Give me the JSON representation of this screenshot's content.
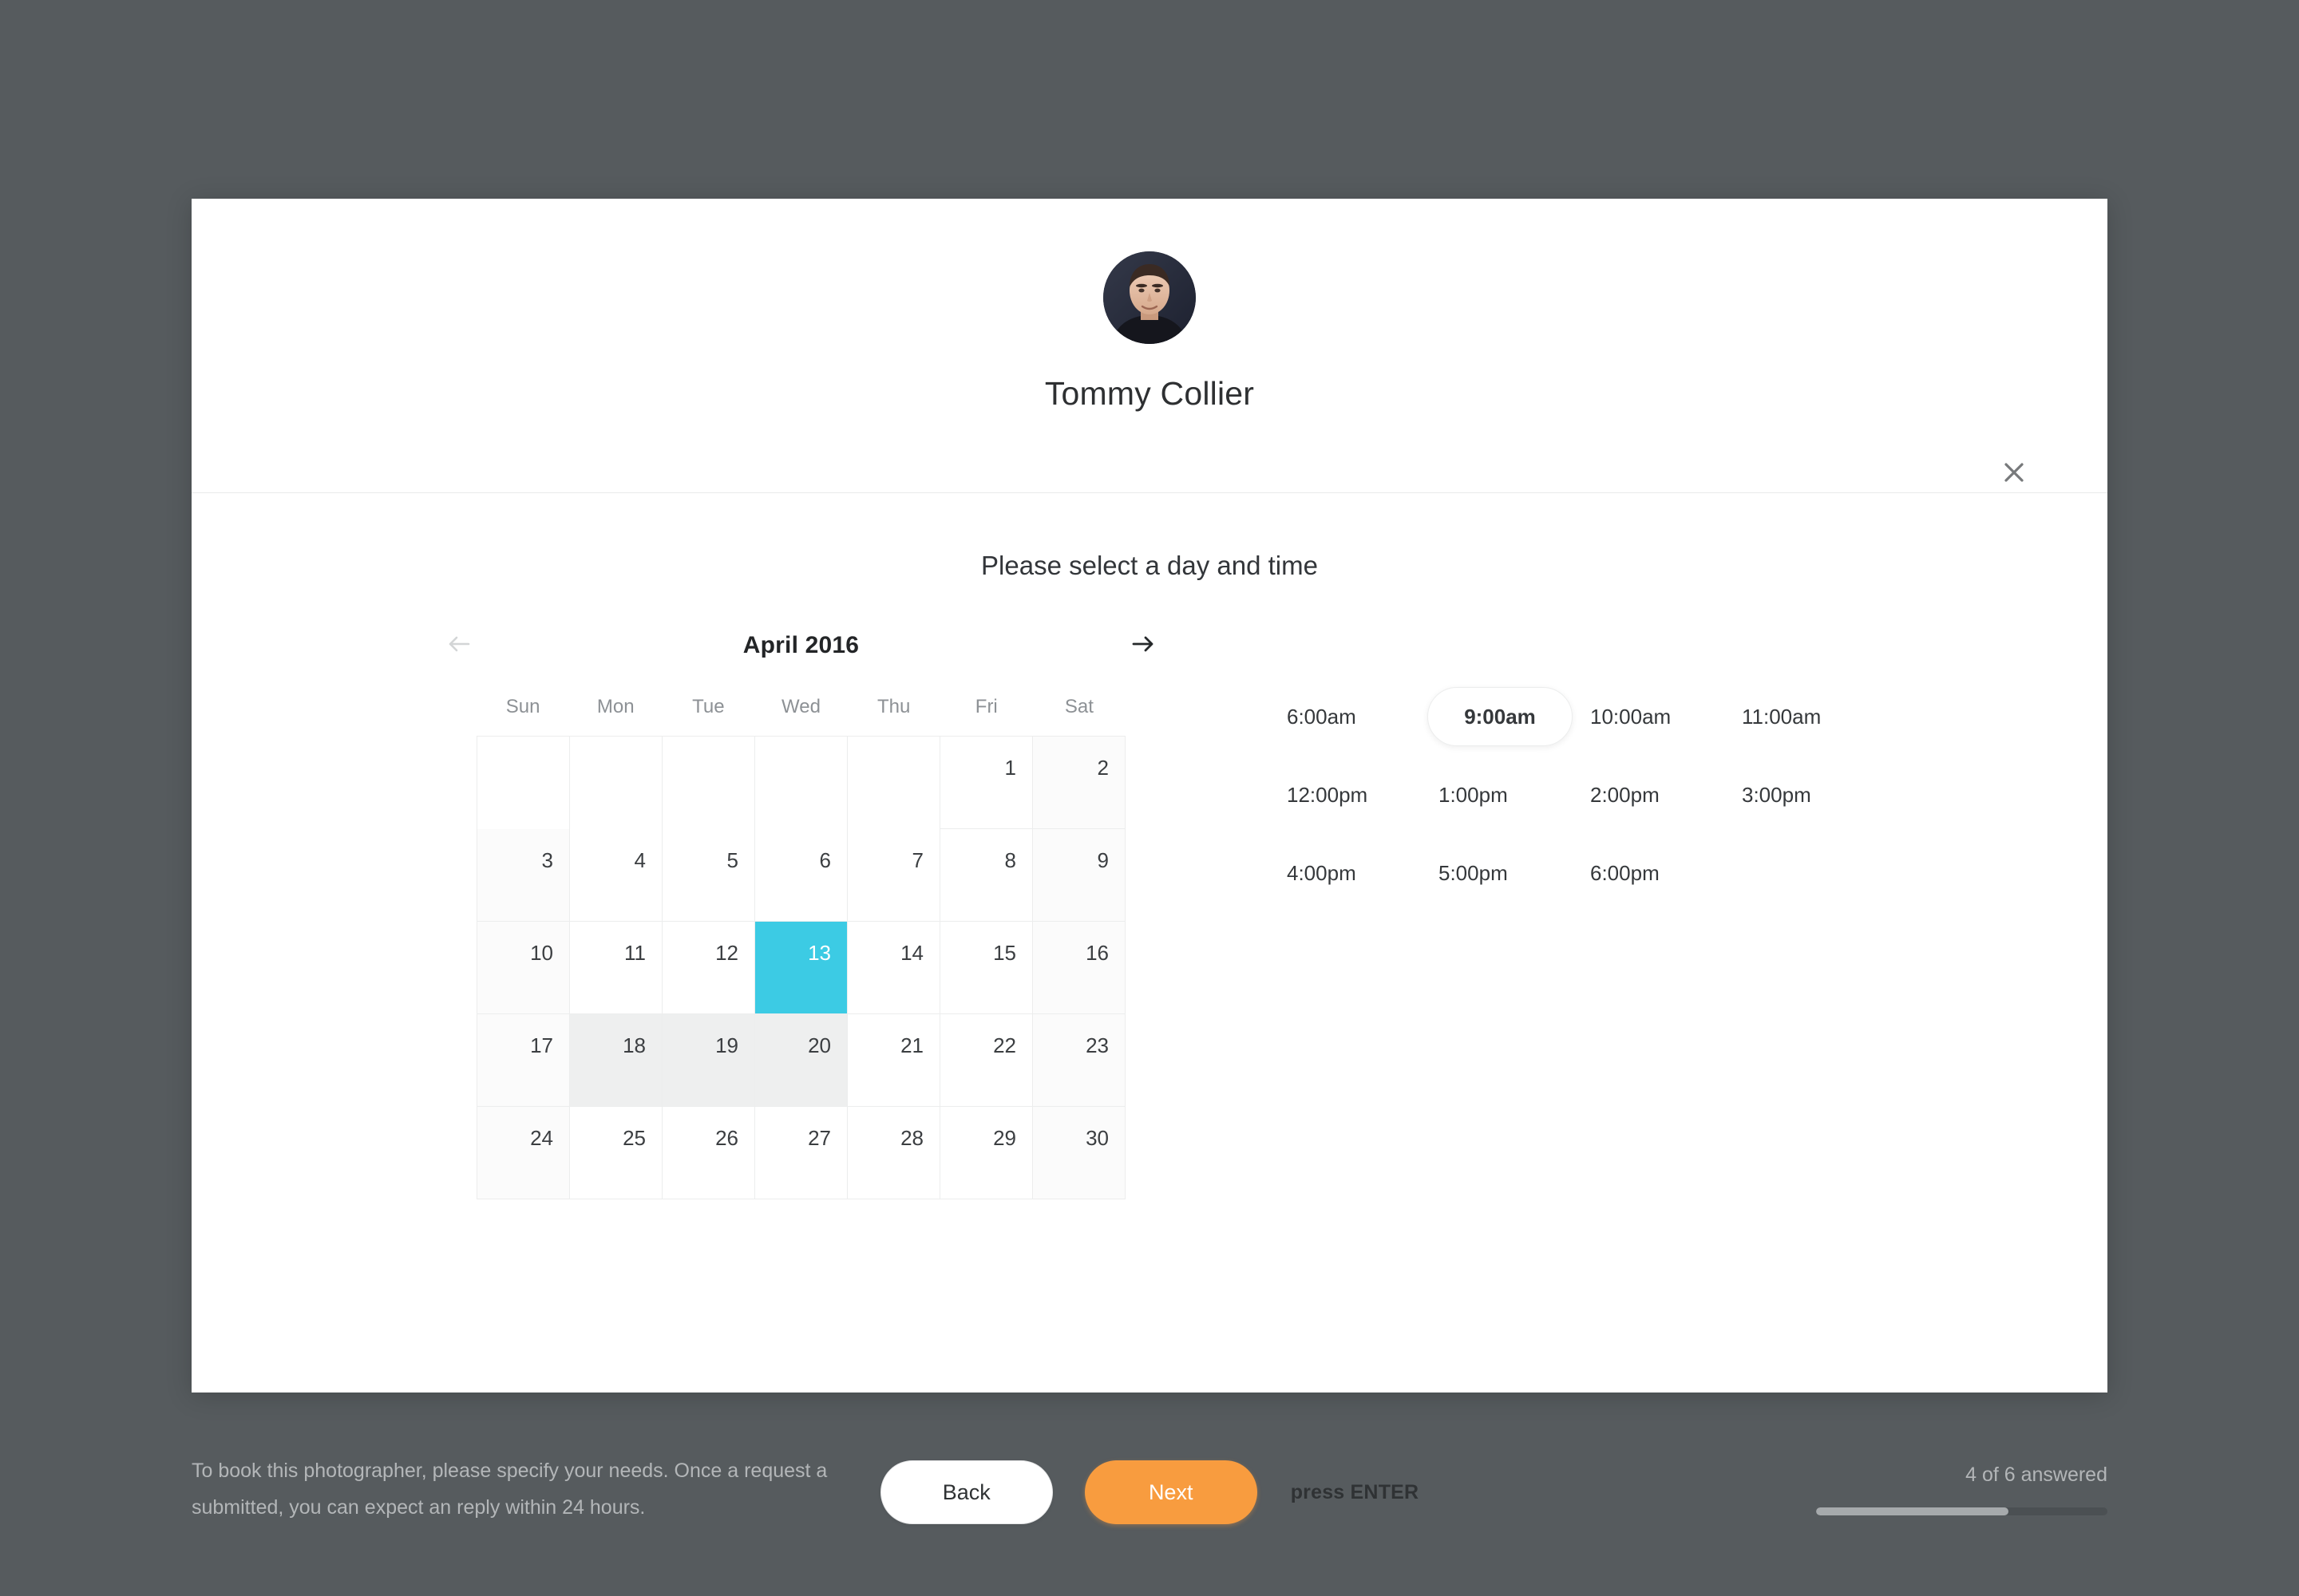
{
  "background_color": "#565b5e",
  "modal": {
    "close_icon": "close-icon",
    "profile": {
      "name": "Tommy Collier",
      "avatar_alt": "avatar"
    },
    "prompt": "Please select a day and time",
    "calendar": {
      "month_label": "April 2016",
      "prev_icon": "arrow-left-icon",
      "next_icon": "arrow-right-icon",
      "prev_enabled": false,
      "next_enabled": true,
      "day_headers": [
        "Sun",
        "Mon",
        "Tue",
        "Wed",
        "Thu",
        "Fri",
        "Sat"
      ],
      "selected_day": 13,
      "dim_days": [
        18,
        19,
        20
      ],
      "leading_blanks": 5,
      "days": [
        1,
        2,
        3,
        4,
        5,
        6,
        7,
        8,
        9,
        10,
        11,
        12,
        13,
        14,
        15,
        16,
        17,
        18,
        19,
        20,
        21,
        22,
        23,
        24,
        25,
        26,
        27,
        28,
        29,
        30
      ],
      "selected_color": "#3ccbe4",
      "dim_color": "#eeefef"
    },
    "timeslots": {
      "selected": "9:00am",
      "rows": [
        [
          "6:00am",
          "9:00am",
          "10:00am",
          "11:00am"
        ],
        [
          "12:00pm",
          "1:00pm",
          "2:00pm",
          "3:00pm"
        ],
        [
          "4:00pm",
          "5:00pm",
          "6:00pm"
        ]
      ]
    },
    "actions": {
      "back_label": "Back",
      "next_label": "Next",
      "hint": "press ENTER",
      "next_color": "#f89c3f"
    }
  },
  "page_footer": {
    "description": "To book this photographer, please specify your needs. Once a request a submitted, you can expect an reply within 24 hours.",
    "progress_label": "4 of 6 answered",
    "progress_percent": 66
  }
}
